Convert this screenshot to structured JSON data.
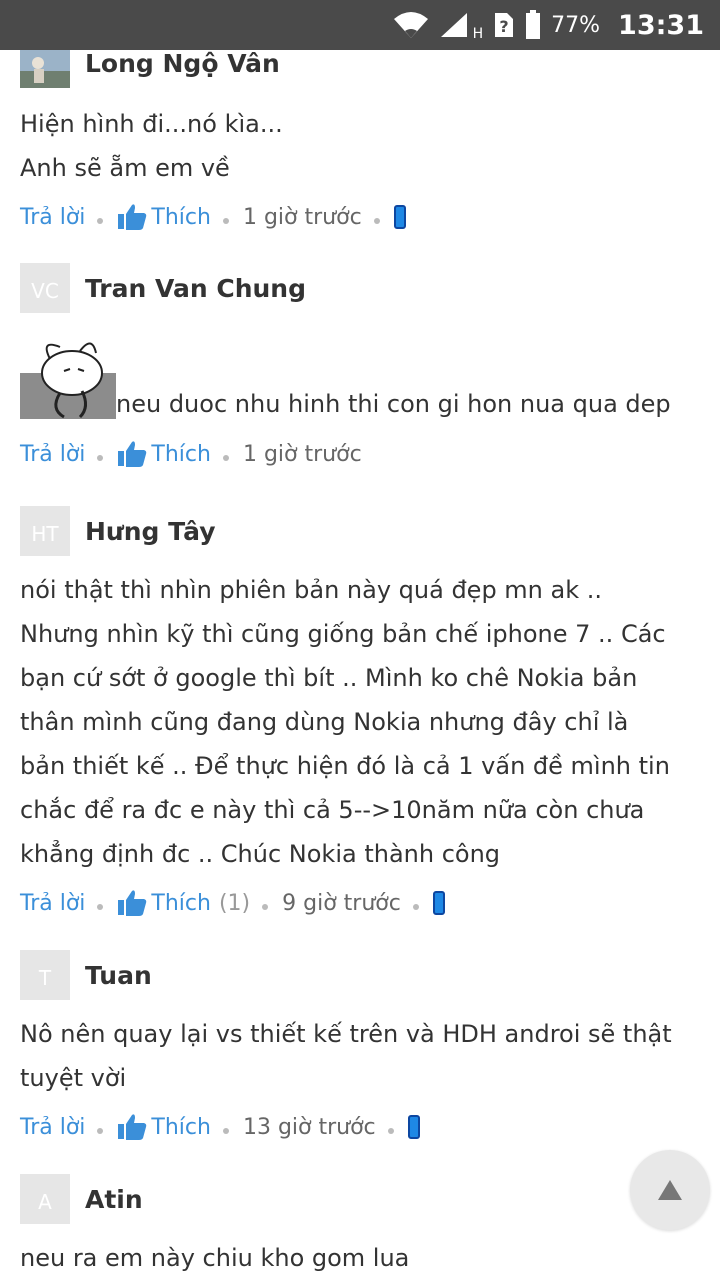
{
  "status_bar": {
    "battery": "77%",
    "time": "13:31",
    "network": "H"
  },
  "action_labels": {
    "reply": "Trả lời",
    "like": "Thích"
  },
  "comments": [
    {
      "author": "Long Ngộ Vân",
      "avatar_initials": "",
      "lines": [
        "Hiện hình đi...nó kìa...",
        "Anh sẽ ẵm em về"
      ],
      "time": "1 giờ trước",
      "like_count": ""
    },
    {
      "author": "Tran Van Chung",
      "avatar_initials": "VC",
      "lines": [
        "neu duoc nhu hinh thi con gi hon nua qua dep"
      ],
      "time": "1 giờ trước",
      "like_count": ""
    },
    {
      "author": "Hưng Tây",
      "avatar_initials": "HT",
      "lines": [
        "nói thật thì nhìn phiên bản này quá đẹp mn ak ..",
        "Nhưng nhìn kỹ thì cũng giống bản chế iphone 7 .. Các",
        "bạn cứ sớt ở google thì bít .. Mình ko chê Nokia bản",
        "thân mình cũng đang dùng Nokia nhưng đây chỉ là",
        "bản thiết kế .. Để thực hiện đó là cả 1 vấn đề mình tin",
        "chắc để ra đc e này thì cả 5-->10năm nữa còn chưa",
        "khẳng định đc .. Chúc Nokia thành công"
      ],
      "time": "9 giờ trước",
      "like_count": "(1)"
    },
    {
      "author": "Tuan",
      "avatar_initials": "T",
      "lines": [
        "Nô nên quay lại vs thiết kế trên và HDH androi sẽ thật",
        "tuyệt vời"
      ],
      "time": "13 giờ trước",
      "like_count": ""
    },
    {
      "author": "Atin",
      "avatar_initials": "A",
      "lines": [
        "neu ra em này chiu kho gom lua"
      ],
      "time": "",
      "like_count": ""
    }
  ]
}
